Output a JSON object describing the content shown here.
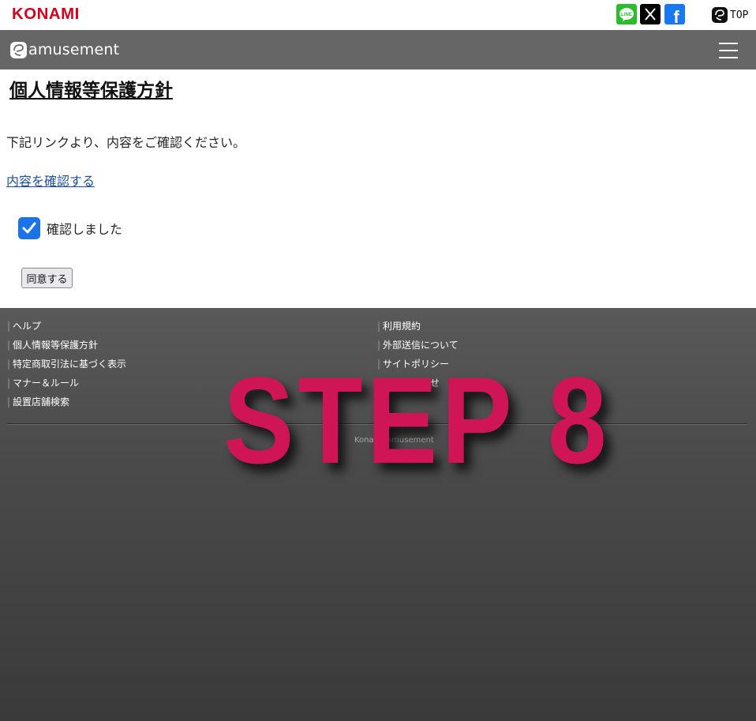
{
  "topbar": {
    "brand": "KONAMI",
    "social": [
      {
        "name": "line",
        "label": "LINE",
        "color": "#2bbd2b"
      },
      {
        "name": "x",
        "label": "X",
        "color": "#000000"
      },
      {
        "name": "facebook",
        "label": "f",
        "color": "#1877f2"
      }
    ],
    "etop_label": "TOP"
  },
  "header": {
    "logo_text": "amusement",
    "menu_icon": "hamburger-icon",
    "background": "#666666"
  },
  "main": {
    "title": "個人情報等保護方針",
    "intro": "下記リンクより、内容をご確認ください。",
    "link": "内容を確認する",
    "checkbox": {
      "label": "確認しました",
      "checked": true,
      "color": "#1a73e8"
    },
    "agree_button": "同意する"
  },
  "footer": {
    "left_links": [
      "ヘルプ",
      "個人情報等保護方針",
      "特定商取引法に基づく表示",
      "マナー＆ルール",
      "設置店舗検索"
    ],
    "right_links": [
      "利用規約",
      "外部送信について",
      "サイトポリシー",
      "お問い合わせ"
    ],
    "copyright": "Konami Amusement"
  },
  "overlay": {
    "text": "STEP 8",
    "color": "#d01557"
  }
}
